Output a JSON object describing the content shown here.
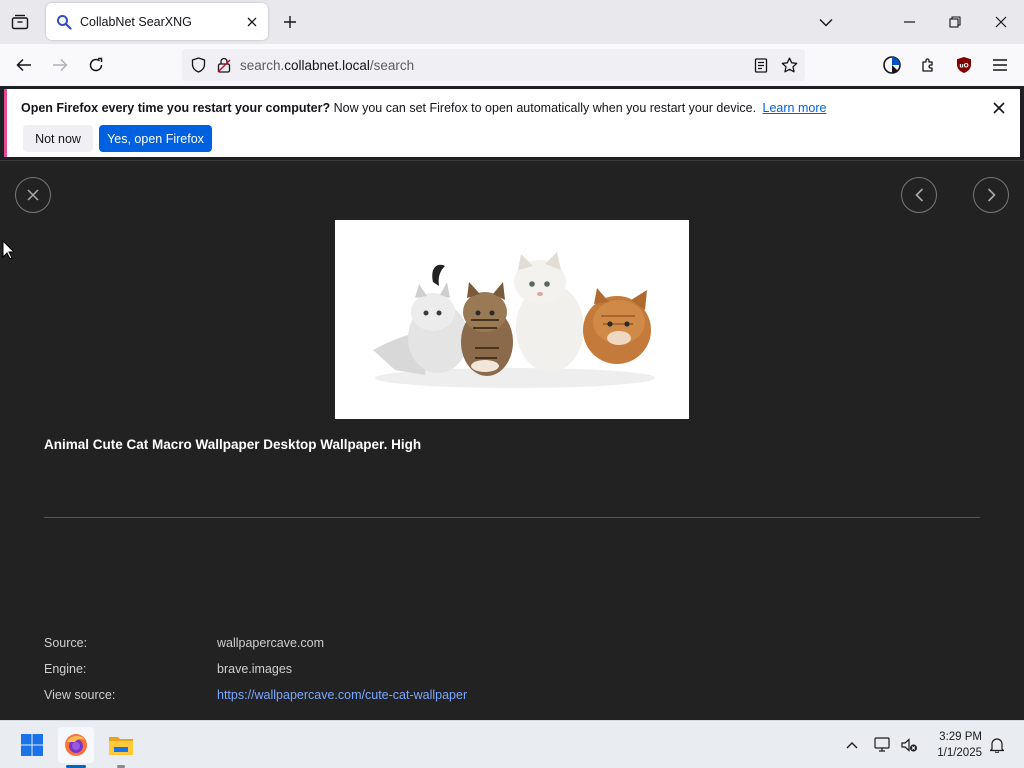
{
  "browser": {
    "tab_title": "CollabNet SearXNG",
    "url_host": "collabnet.local",
    "url_prefix": "search.",
    "url_path": "/search"
  },
  "notification": {
    "bold_text": "Open Firefox every time you restart your computer?",
    "body_text": "Now you can set Firefox to open automatically when you restart your device.",
    "learn_more": "Learn more",
    "not_now": "Not now",
    "yes_open": "Yes, open Firefox"
  },
  "viewer": {
    "title": "Animal Cute Cat Macro Wallpaper Desktop Wallpaper. High",
    "details": [
      {
        "label": "Source:",
        "value": "wallpapercave.com"
      },
      {
        "label": "Engine:",
        "value": "brave.images"
      },
      {
        "label": "View source:",
        "value": "https://wallpapercave.com/cute-cat-wallpaper"
      }
    ]
  },
  "taskbar": {
    "time": "3:29 PM",
    "date": "1/1/2025"
  },
  "colors": {
    "accent": "#0061e0",
    "link": "#7aa7ff",
    "content_bg": "#222222"
  }
}
